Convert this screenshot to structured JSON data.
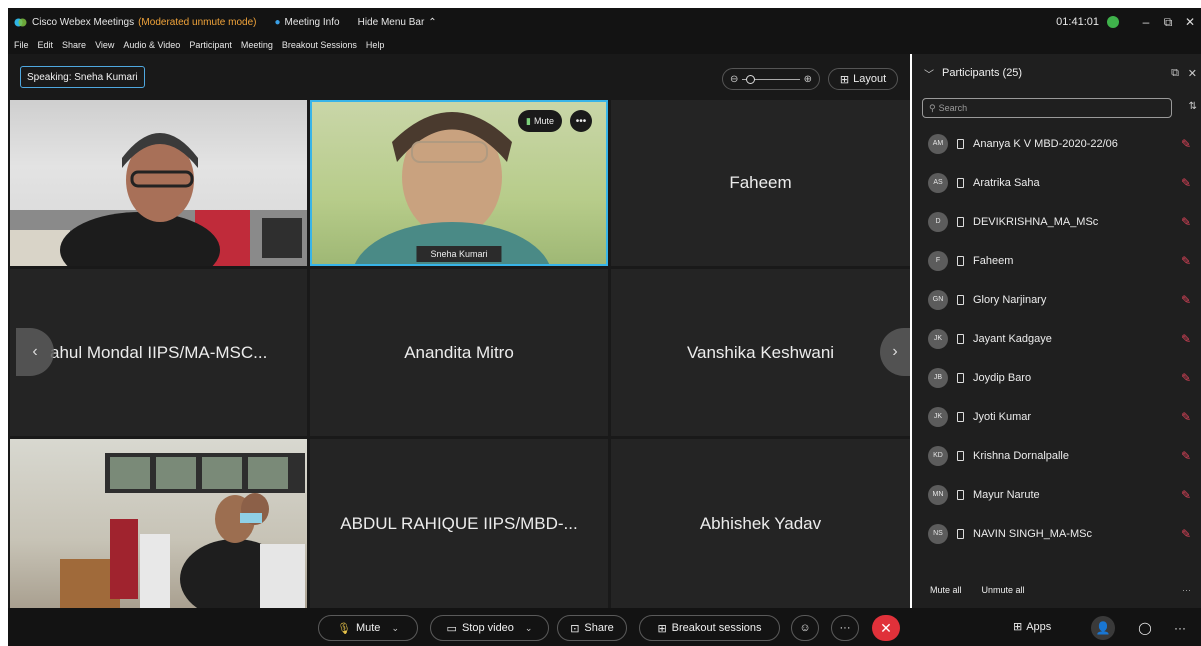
{
  "titlebar": {
    "app_title": "Cisco Webex Meetings",
    "mode": "(Moderated unmute mode)",
    "meeting_info": "Meeting Info",
    "hide_menu": "Hide Menu Bar",
    "clock": "01:41:01"
  },
  "menu": [
    "File",
    "Edit",
    "Share",
    "View",
    "Audio & Video",
    "Participant",
    "Meeting",
    "Breakout Sessions",
    "Help"
  ],
  "stage": {
    "speaking": "Speaking: Sneha Kumari",
    "layout_label": "Layout",
    "tiles": {
      "tile_video_self": "Sneha Kumari",
      "tile_mute": "Mute",
      "t3": "Faheem",
      "t4": "ahul Mondal IIPS/MA-MSC...",
      "t5": "Anandita Mitro",
      "t6": "Vanshika Keshwani",
      "t8": "ABDUL RAHIQUE IIPS/MBD-...",
      "t9": "Abhishek Yadav"
    }
  },
  "panel": {
    "title": "Participants (25)",
    "search_placeholder": "Search",
    "participants": [
      {
        "initials": "AM",
        "name": "Ananya K V MBD-2020-22/06"
      },
      {
        "initials": "AS",
        "name": "Aratrika Saha"
      },
      {
        "initials": "D",
        "name": "DEVIKRISHNA_MA_MSc"
      },
      {
        "initials": "F",
        "name": "Faheem"
      },
      {
        "initials": "GN",
        "name": "Glory Narjinary"
      },
      {
        "initials": "JK",
        "name": "Jayant Kadgaye"
      },
      {
        "initials": "JB",
        "name": "Joydip Baro"
      },
      {
        "initials": "JK",
        "name": "Jyoti Kumar"
      },
      {
        "initials": "KD",
        "name": "Krishna Dornalpalle"
      },
      {
        "initials": "MN",
        "name": "Mayur Narute"
      },
      {
        "initials": "NS",
        "name": "NAVIN SINGH_MA-MSc"
      }
    ],
    "mute_all": "Mute all",
    "unmute_all": "Unmute all"
  },
  "controls": {
    "mute": "Mute",
    "stop_video": "Stop video",
    "share": "Share",
    "breakout": "Breakout sessions",
    "apps": "Apps"
  },
  "colors": {
    "accent": "#38b4e8",
    "end_call": "#e0313a",
    "mode_text": "#f0a33a",
    "status_online": "#3fb24b",
    "muted_mic": "#e0445a"
  }
}
